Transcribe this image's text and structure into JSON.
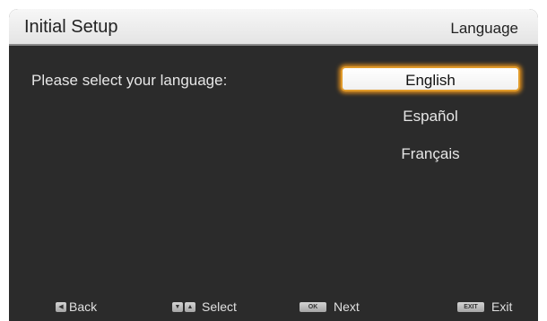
{
  "header": {
    "title": "Initial Setup",
    "section": "Language"
  },
  "prompt": "Please select your language:",
  "languages": {
    "selected_index": 0,
    "items": [
      "English",
      "Español",
      "Français"
    ]
  },
  "footer": {
    "back": {
      "icon": "left-arrow-key-icon",
      "label": "Back"
    },
    "select": {
      "icons": [
        "down-arrow-key-icon",
        "up-arrow-key-icon"
      ],
      "label": "Select"
    },
    "next": {
      "key": "OK",
      "label": "Next"
    },
    "exit": {
      "key": "EXIT",
      "label": "Exit"
    }
  },
  "colors": {
    "screen_bg": "#2b2b2b",
    "header_bg": "#ececec",
    "highlight_border": "#e09a2a",
    "text": "#e6e6e6"
  }
}
